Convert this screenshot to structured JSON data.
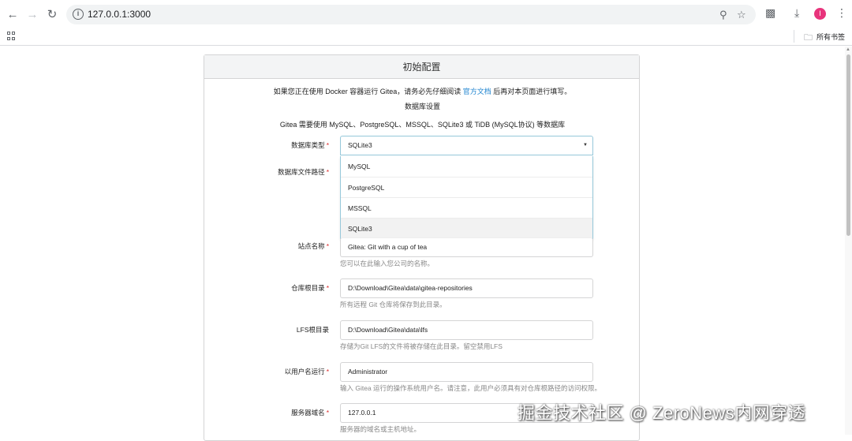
{
  "browser": {
    "url": "127.0.0.1:3000",
    "avatar_letter": "I",
    "all_bookmarks": "所有书签"
  },
  "page": {
    "header": "初始配置",
    "docker_notice_pre": "如果您正在使用 Docker 容器运行 Gitea，请务必先仔细阅读",
    "docker_notice_link": "官方文档",
    "docker_notice_post": "后再对本页面进行填写。",
    "db_section_title": "数据库设置",
    "db_requirements": "Gitea 需要使用 MySQL、PostgreSQL、MSSQL、SQLite3 或 TiDB (MySQL协议) 等数据库"
  },
  "form": {
    "db_type": {
      "label": "数据库类型",
      "value": "SQLite3",
      "options": [
        "MySQL",
        "PostgreSQL",
        "MSSQL",
        "SQLite3"
      ]
    },
    "db_path": {
      "label": "数据库文件路径"
    },
    "site_name": {
      "label": "站点名称",
      "value": "Gitea: Git with a cup of tea",
      "help": "您可以在此输入您公司的名称。"
    },
    "repo_root": {
      "label": "仓库根目录",
      "value": "D:\\Download\\Gitea\\data\\gitea-repositories",
      "help": "所有远程 Git 仓库将保存到此目录。"
    },
    "lfs_root": {
      "label": "LFS根目录",
      "value": "D:\\Download\\Gitea\\data\\lfs",
      "help": "存储为Git LFS的文件将被存储在此目录。留空禁用LFS"
    },
    "run_user": {
      "label": "以用户名运行",
      "value": "Administrator",
      "help": "输入 Gitea 运行的操作系统用户名。请注意，此用户必须具有对仓库根路径的访问权限。"
    },
    "domain": {
      "label": "服务器域名",
      "value": "127.0.0.1",
      "help": "服务器的域名或主机地址。"
    }
  },
  "watermark": "掘金技术社区 @ ZeroNews内网穿透"
}
